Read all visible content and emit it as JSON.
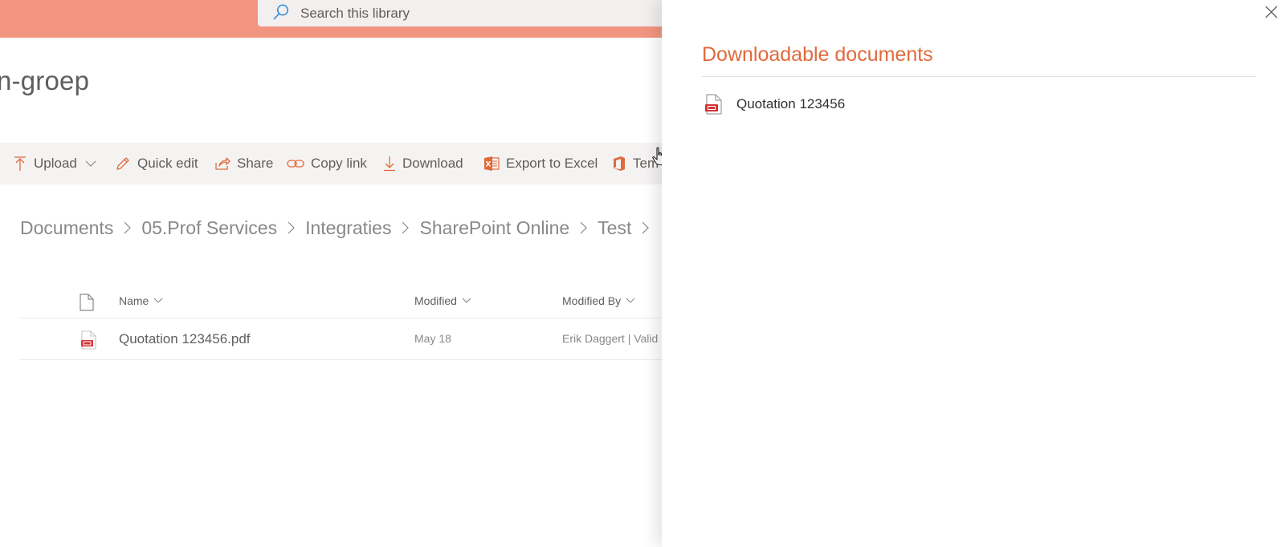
{
  "search": {
    "placeholder": "Search this library"
  },
  "site": {
    "title": "n-groep"
  },
  "toolbar": {
    "upload": "Upload",
    "quick_edit": "Quick edit",
    "share": "Share",
    "copy_link": "Copy link",
    "download": "Download",
    "export_excel": "Export to Excel",
    "templates": "Tem"
  },
  "breadcrumb": [
    "Documents",
    "05.Prof Services",
    "Integraties",
    "SharePoint Online",
    "Test"
  ],
  "list": {
    "columns": {
      "name": "Name",
      "modified": "Modified",
      "modified_by": "Modified By"
    },
    "rows": [
      {
        "name": "Quotation 123456.pdf",
        "modified": "May 18",
        "modified_by": "Erik Daggert | Valid"
      }
    ]
  },
  "panel": {
    "title": "Downloadable documents",
    "documents": [
      {
        "label": "Quotation 123456"
      }
    ]
  },
  "colors": {
    "suite_bar": "#f29580",
    "accent": "#e06a3c",
    "pdf_red": "#d13438"
  }
}
